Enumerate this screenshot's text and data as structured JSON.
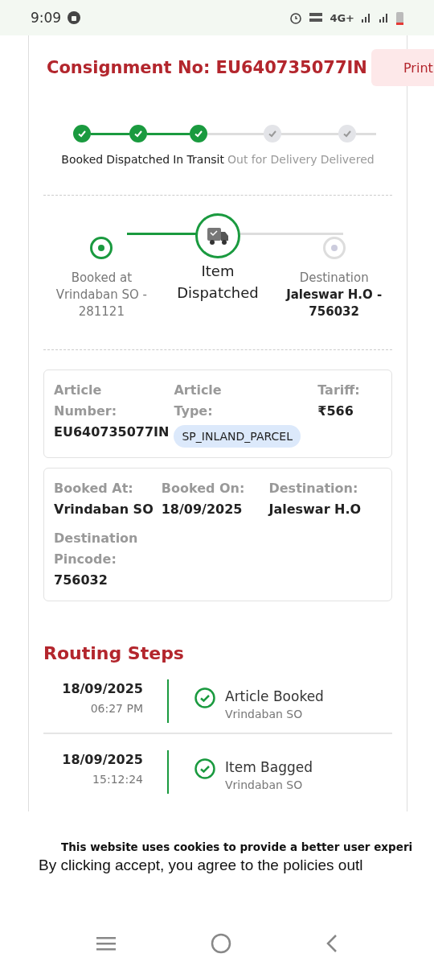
{
  "status_bar": {
    "time": "9:09",
    "network": "4G+"
  },
  "header": {
    "title": "Consignment No: EU640735077IN",
    "print_button": "Print"
  },
  "progress_steps": [
    {
      "label": "Booked",
      "done": true
    },
    {
      "label": "Dispatched",
      "done": true
    },
    {
      "label": "In Transit",
      "done": true
    },
    {
      "label": "Out for Delivery",
      "done": false
    },
    {
      "label": "Delivered",
      "done": false
    }
  ],
  "journey": {
    "origin": {
      "caption": "Booked at",
      "place": "Vrindaban SO - 281121",
      "reached": true
    },
    "current": {
      "label": "Item Dispatched"
    },
    "destination": {
      "caption": "Destination",
      "place": "Jaleswar H.O - 756032",
      "reached": false
    }
  },
  "article_card": {
    "fields": [
      {
        "label": "Article Number:",
        "value": "EU640735077IN",
        "kind": "text"
      },
      {
        "label": "Article Type:",
        "value": "SP_INLAND_PARCEL",
        "kind": "pill"
      },
      {
        "label": "Tariff:",
        "value": "₹566",
        "kind": "text"
      }
    ]
  },
  "booking_card": {
    "fields": [
      {
        "label": "Booked At:",
        "value": "Vrindaban SO"
      },
      {
        "label": "Booked On:",
        "value": "18/09/2025"
      },
      {
        "label": "Destination:",
        "value": "Jaleswar H.O"
      },
      {
        "label": "Destination Pincode:",
        "value": "756032"
      }
    ]
  },
  "routing": {
    "title": "Routing Steps",
    "steps": [
      {
        "date": "18/09/2025",
        "time": "06:27 PM",
        "event": "Article Booked",
        "office": "Vrindaban SO"
      },
      {
        "date": "18/09/2025",
        "time": "15:12:24",
        "event": "Item Bagged",
        "office": "Vrindaban SO"
      }
    ]
  },
  "cookie_banner": {
    "heading": "This website uses cookies to provide a better user experi",
    "text": "By clicking accept, you agree to the policies outl"
  }
}
